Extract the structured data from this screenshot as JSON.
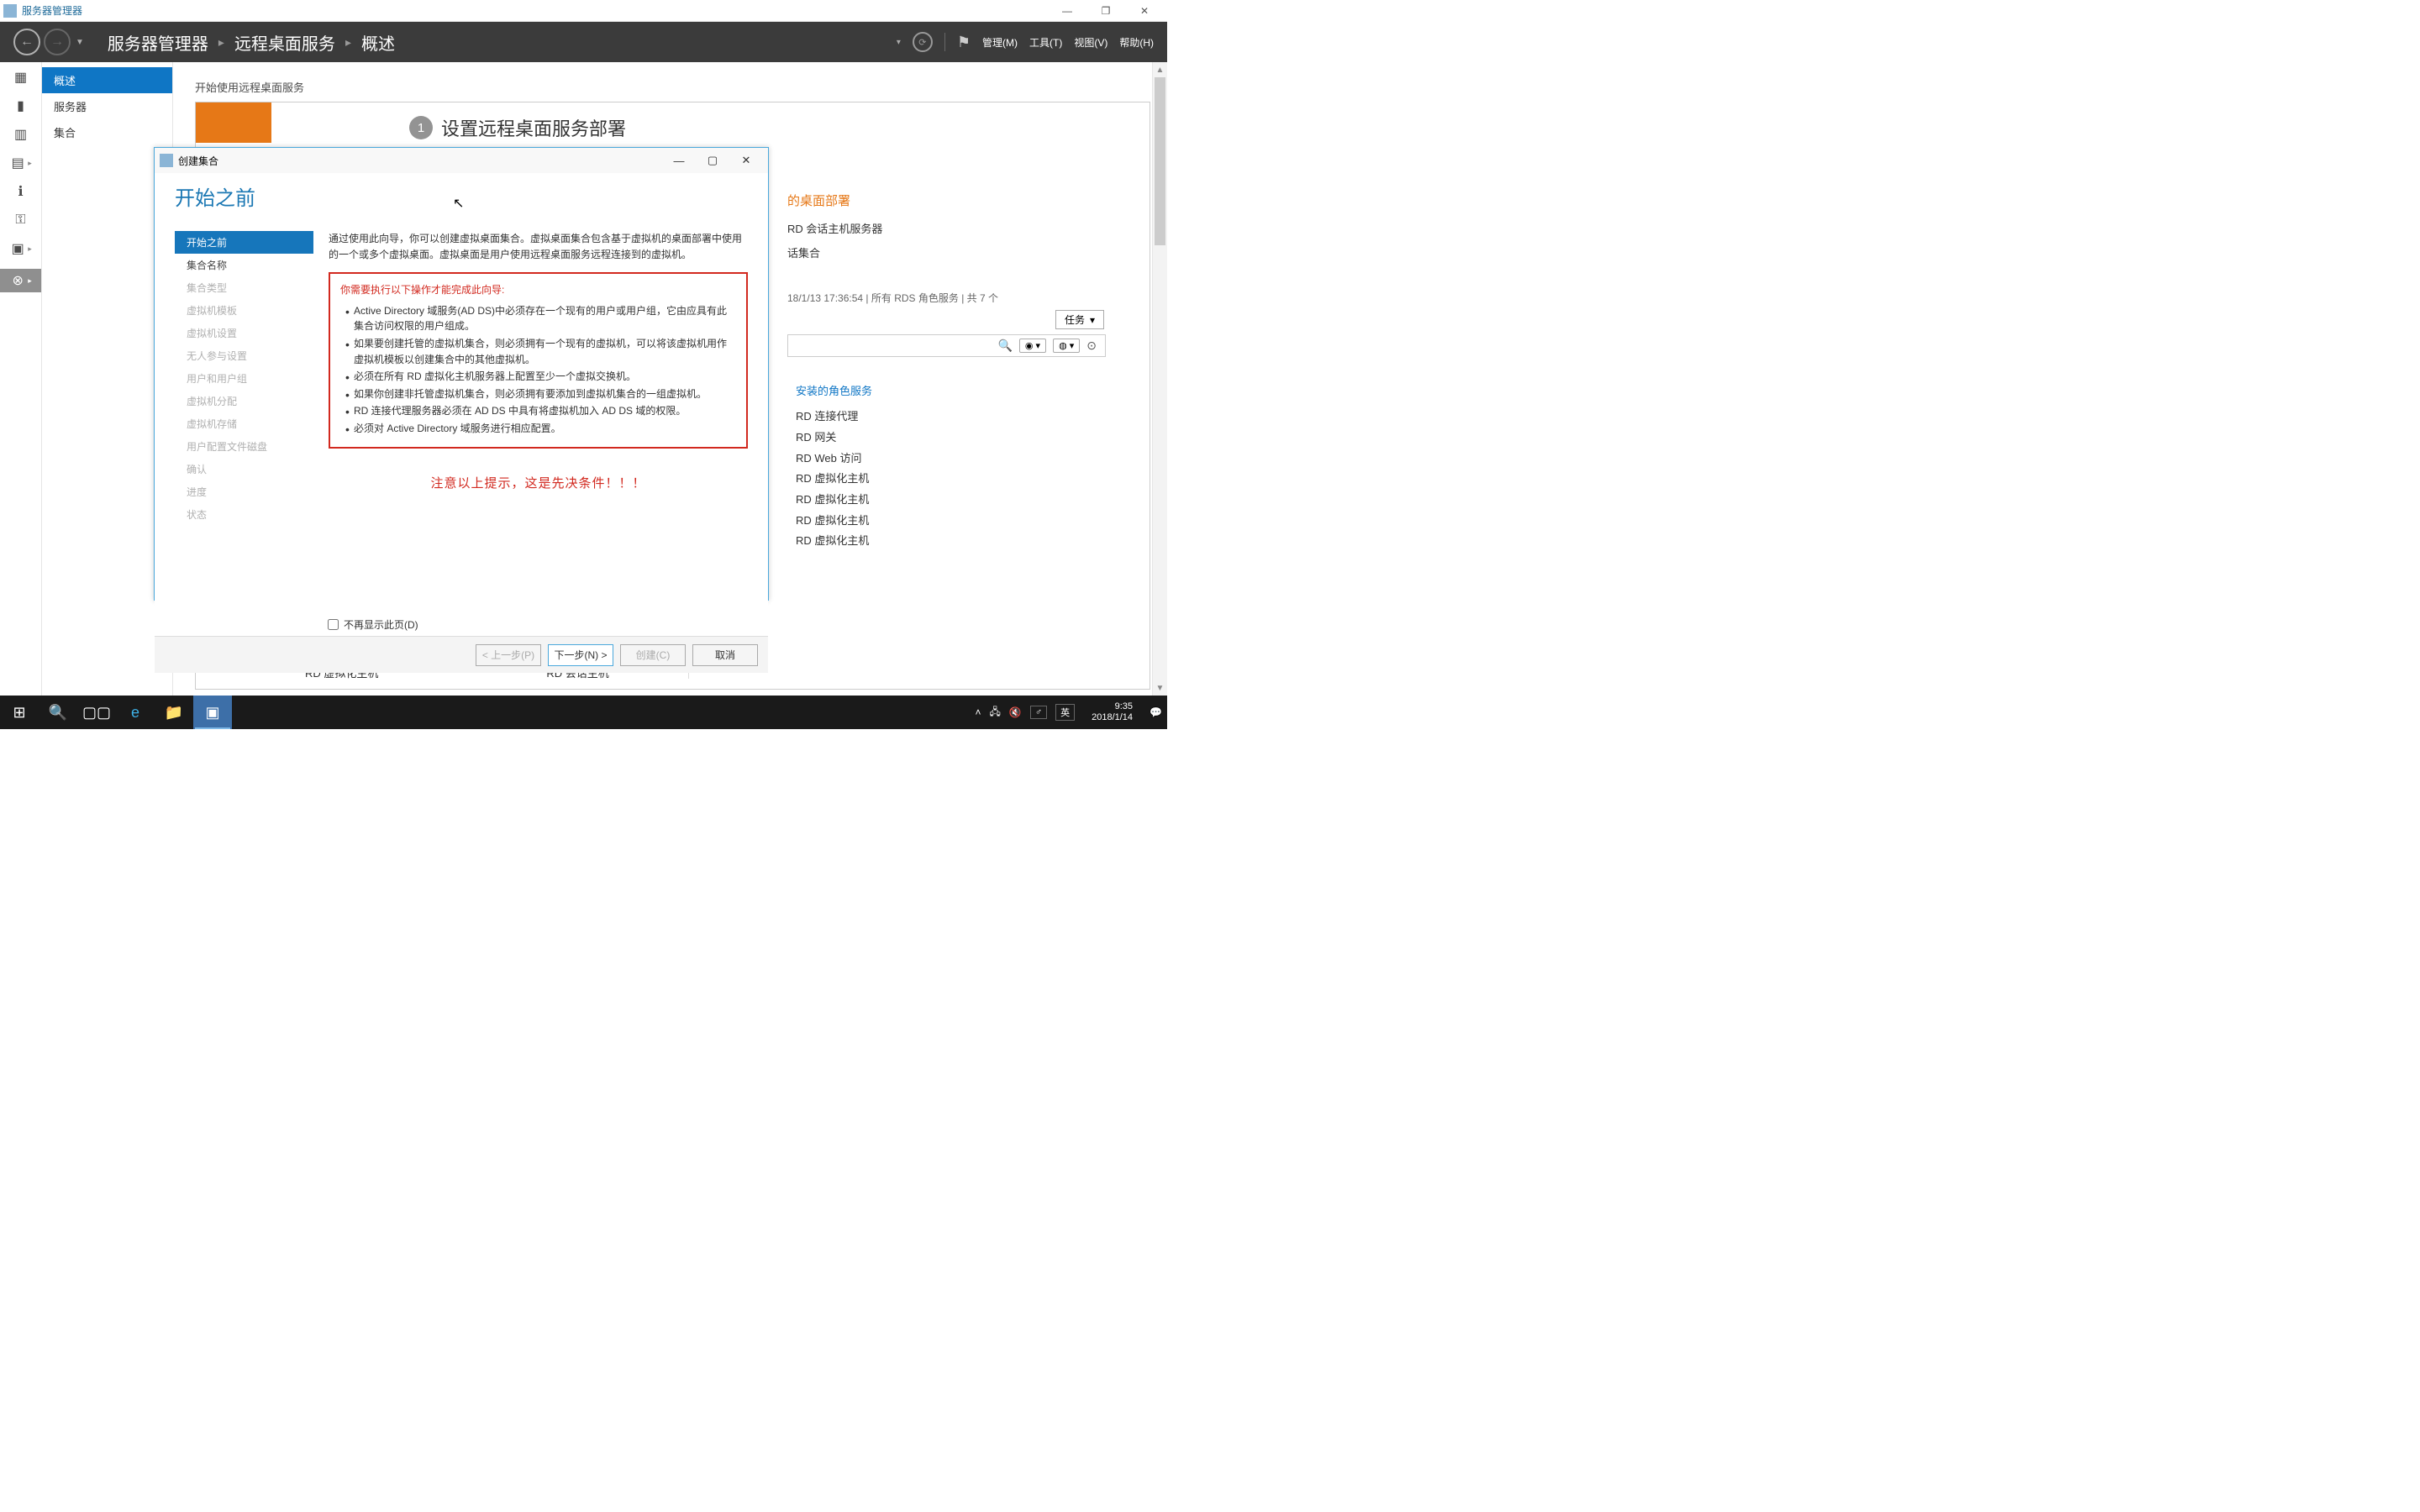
{
  "window": {
    "title": "服务器管理器",
    "minimize": "—",
    "maximize": "❐",
    "close": "✕"
  },
  "nav_header": {
    "breadcrumb": [
      "服务器管理器",
      "远程桌面服务",
      "概述"
    ],
    "sep": "▸",
    "menus": {
      "manage": "管理(M)",
      "tools": "工具(T)",
      "view": "视图(V)",
      "help": "帮助(H)"
    }
  },
  "left_nav": {
    "items": [
      "概述",
      "服务器",
      "集合"
    ],
    "selected_index": 0
  },
  "section_title": "开始使用远程桌面服务",
  "big_step": {
    "num": "1",
    "title": "设置远程桌面服务部署"
  },
  "sub_heading": "的桌面部署",
  "bg_list": [
    "RD 会话主机服务器",
    "话集合"
  ],
  "meta_line": "18/1/13 17:36:54 | 所有 RDS 角色服务 | 共 7 个",
  "tasks_label": "任务",
  "search": {
    "placeholder": "",
    "icon_h": "H",
    "icon_r": "R"
  },
  "roles_header": "安装的角色服务",
  "roles": [
    "RD 连接代理",
    "RD 网关",
    "RD Web 访问",
    "RD 虚拟化主机",
    "RD 虚拟化主机",
    "RD 虚拟化主机",
    "RD 虚拟化主机"
  ],
  "bottom_icons": {
    "left": "RD 虚拟化主机",
    "right": "RD 会话主机"
  },
  "modal": {
    "title": "创建集合",
    "heading": "开始之前",
    "steps": [
      "开始之前",
      "集合名称",
      "集合类型",
      "虚拟机模板",
      "虚拟机设置",
      "无人参与设置",
      "用户和用户组",
      "虚拟机分配",
      "虚拟机存储",
      "用户配置文件磁盘",
      "确认",
      "进度",
      "状态"
    ],
    "intro": "通过使用此向导，你可以创建虚拟桌面集合。虚拟桌面集合包含基于虚拟机的桌面部署中使用的一个或多个虚拟桌面。虚拟桌面是用户使用远程桌面服务远程连接到的虚拟机。",
    "req_intro": "你需要执行以下操作才能完成此向导:",
    "req_items": [
      "Active Directory 域服务(AD DS)中必须存在一个现有的用户或用户组，它由应具有此集合访问权限的用户组成。",
      "如果要创建托管的虚拟机集合，则必须拥有一个现有的虚拟机，可以将该虚拟机用作虚拟机模板以创建集合中的其他虚拟机。",
      "必须在所有 RD 虚拟化主机服务器上配置至少一个虚拟交换机。",
      "如果你创建非托管虚拟机集合，则必须拥有要添加到虚拟机集合的一组虚拟机。",
      "RD 连接代理服务器必须在 AD DS 中具有将虚拟机加入 AD DS 域的权限。",
      "必须对 Active Directory 域服务进行相应配置。"
    ],
    "red_note": "注意以上提示，这是先决条件！！！",
    "checkbox": "不再显示此页(D)",
    "buttons": {
      "prev": "< 上一步(P)",
      "next": "下一步(N) >",
      "create": "创建(C)",
      "cancel": "取消"
    }
  },
  "taskbar": {
    "lang1": "英",
    "lang2": "英",
    "time": "9:35",
    "date": "2018/1/14"
  }
}
